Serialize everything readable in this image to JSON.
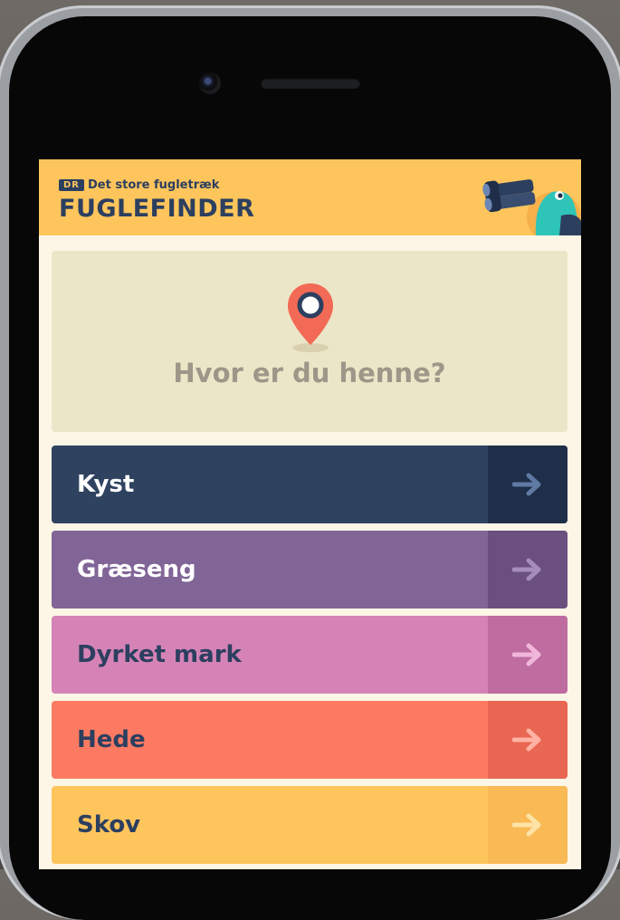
{
  "app": {
    "brand_badge": "DR",
    "brand_subtitle": "Det store fugletræk",
    "brand_title": "FUGLEFINDER"
  },
  "location": {
    "prompt": "Hvor er du henne?",
    "icon": "map-pin-icon"
  },
  "habitats": [
    {
      "label": "Kyst",
      "bg": "#2f4260",
      "arrow_bg": "#1f2f4a",
      "text_color": "#ffffff",
      "arrow_color": "#5f7aa3",
      "icon": "arrow-right-icon"
    },
    {
      "label": "Græseng",
      "bg": "#816597",
      "arrow_bg": "#6a4f7f",
      "text_color": "#ffffff",
      "arrow_color": "#a58cbd",
      "icon": "arrow-right-icon"
    },
    {
      "label": "Dyrket mark",
      "bg": "#d583b6",
      "arrow_bg": "#bf6ca1",
      "text_color": "#2c3f5f",
      "arrow_color": "#f1b7da",
      "icon": "arrow-right-icon"
    },
    {
      "label": "Hede",
      "bg": "#fd7a62",
      "arrow_bg": "#e96652",
      "text_color": "#2c3f5f",
      "arrow_color": "#ffb2a3",
      "icon": "arrow-right-icon"
    },
    {
      "label": "Skov",
      "bg": "#fdc55c",
      "arrow_bg": "#f9b955",
      "text_color": "#2c3f5f",
      "arrow_color": "#fde3a6",
      "icon": "arrow-right-icon"
    }
  ]
}
